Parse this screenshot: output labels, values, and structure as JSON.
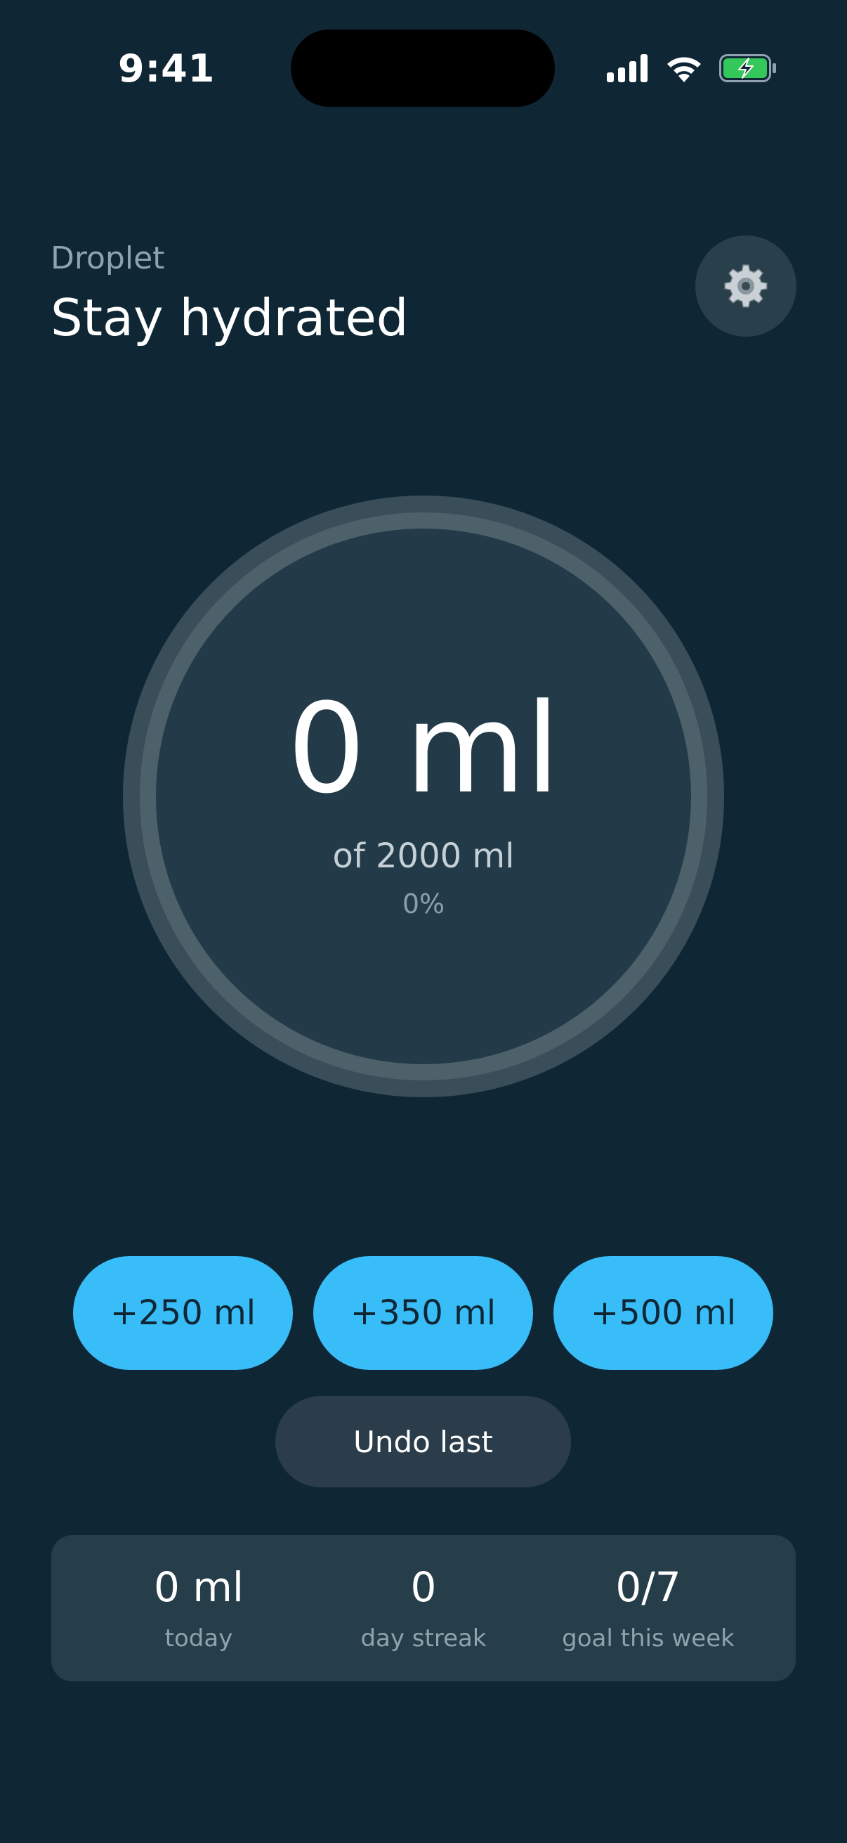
{
  "status_bar": {
    "time": "9:41",
    "icons": [
      "signal-icon",
      "wifi-icon",
      "battery-charging-icon"
    ],
    "battery_color": "#34c759"
  },
  "header": {
    "app_name": "Droplet",
    "title": "Stay hydrated",
    "settings_icon": "gear-icon"
  },
  "progress": {
    "intake": "0 ml",
    "goal": "of 2000 ml",
    "percent_label": "0%",
    "fraction": 0
  },
  "quick_add": [
    {
      "label": "+250 ml"
    },
    {
      "label": "+350 ml"
    },
    {
      "label": "+500 ml"
    }
  ],
  "undo": {
    "label": "Undo last"
  },
  "stats": [
    {
      "value": "0 ml",
      "label": "today"
    },
    {
      "value": "0",
      "label": "day streak"
    },
    {
      "value": "0/7",
      "label": "goal this week"
    }
  ],
  "colors": {
    "background": "#0f2735",
    "accent": "#38bdf8",
    "card": "#263d4a",
    "ring_track": "#4a5f6a",
    "ring_inner": "#233a48"
  }
}
